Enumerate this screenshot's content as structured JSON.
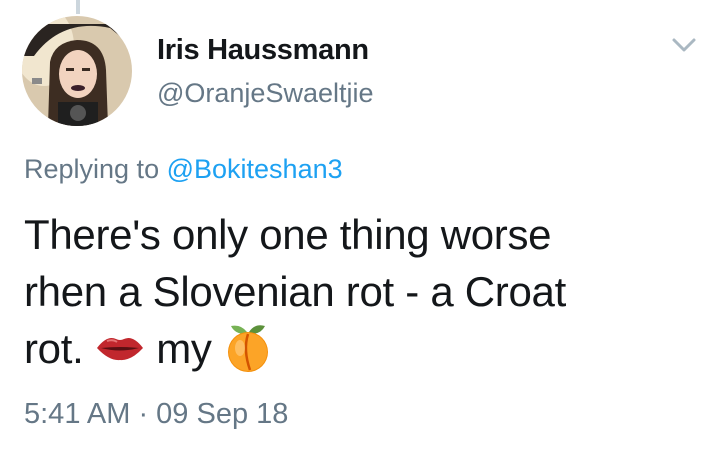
{
  "tweet": {
    "author": {
      "display_name": "Iris Haussmann",
      "handle": "@OranjeSwaeltjie"
    },
    "reply": {
      "prefix": "Replying to",
      "mention": "@Bokiteshan3"
    },
    "text": {
      "line1": "There's only one thing worse",
      "line2": "rhen a Slovenian rot - a Croat",
      "line3_a": "rot.",
      "line3_b": "my",
      "emoji_1": "lips-emoji",
      "emoji_2": "peach-emoji"
    },
    "timestamp": "5:41 AM · 09 Sep 18"
  },
  "icons": {
    "menu": "chevron-down-icon"
  },
  "colors": {
    "text": "#14171a",
    "secondary": "#657786",
    "link": "#1da1f2"
  }
}
